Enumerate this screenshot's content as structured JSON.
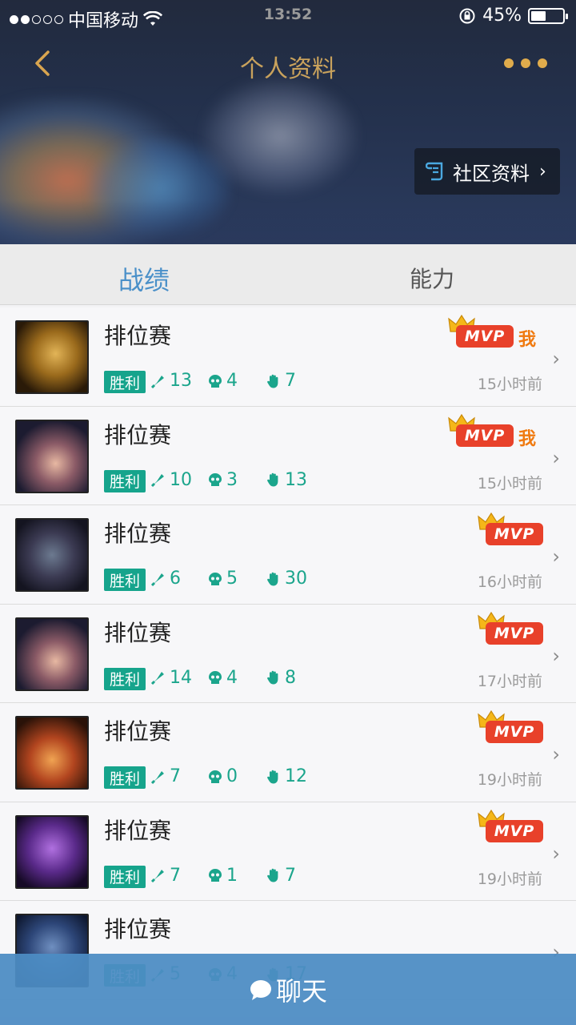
{
  "status_bar": {
    "carrier": "中国移动",
    "time": "13:52",
    "battery": "45%"
  },
  "navbar": {
    "title": "个人资料"
  },
  "community_button": {
    "label": "社区资料"
  },
  "tabs": [
    {
      "label": "战绩",
      "active": true
    },
    {
      "label": "能力",
      "active": false
    }
  ],
  "matches": [
    {
      "mode": "排位赛",
      "result": "胜利",
      "kills": "13",
      "deaths": "4",
      "assists": "7",
      "time": "15小时前",
      "mvp": "MVP",
      "me": "我",
      "avatar": "gold-armored-champion"
    },
    {
      "mode": "排位赛",
      "result": "胜利",
      "kills": "10",
      "deaths": "3",
      "assists": "13",
      "time": "15小时前",
      "mvp": "MVP",
      "me": "我",
      "avatar": "hat-wearing-champion"
    },
    {
      "mode": "排位赛",
      "result": "胜利",
      "kills": "6",
      "deaths": "5",
      "assists": "30",
      "time": "16小时前",
      "mvp": "MVP",
      "me": "",
      "avatar": "armored-brute-champion"
    },
    {
      "mode": "排位赛",
      "result": "胜利",
      "kills": "14",
      "deaths": "4",
      "assists": "8",
      "time": "17小时前",
      "mvp": "MVP",
      "me": "",
      "avatar": "hat-wearing-champion"
    },
    {
      "mode": "排位赛",
      "result": "胜利",
      "kills": "7",
      "deaths": "0",
      "assists": "12",
      "time": "19小时前",
      "mvp": "MVP",
      "me": "",
      "avatar": "fire-warrior-champion"
    },
    {
      "mode": "排位赛",
      "result": "胜利",
      "kills": "7",
      "deaths": "1",
      "assists": "7",
      "time": "19小时前",
      "mvp": "MVP",
      "me": "",
      "avatar": "purple-void-champion"
    },
    {
      "mode": "排位赛",
      "result": "胜利",
      "kills": "5",
      "deaths": "4",
      "assists": "17",
      "time": "",
      "mvp": "",
      "me": "",
      "avatar": "blue-hooded-champion"
    }
  ],
  "chat_bar": {
    "label": "聊天"
  },
  "colors": {
    "accent": "#4a90c9",
    "win": "#16a48c",
    "mvp": "#e8412a",
    "gold": "#c9a25c"
  }
}
